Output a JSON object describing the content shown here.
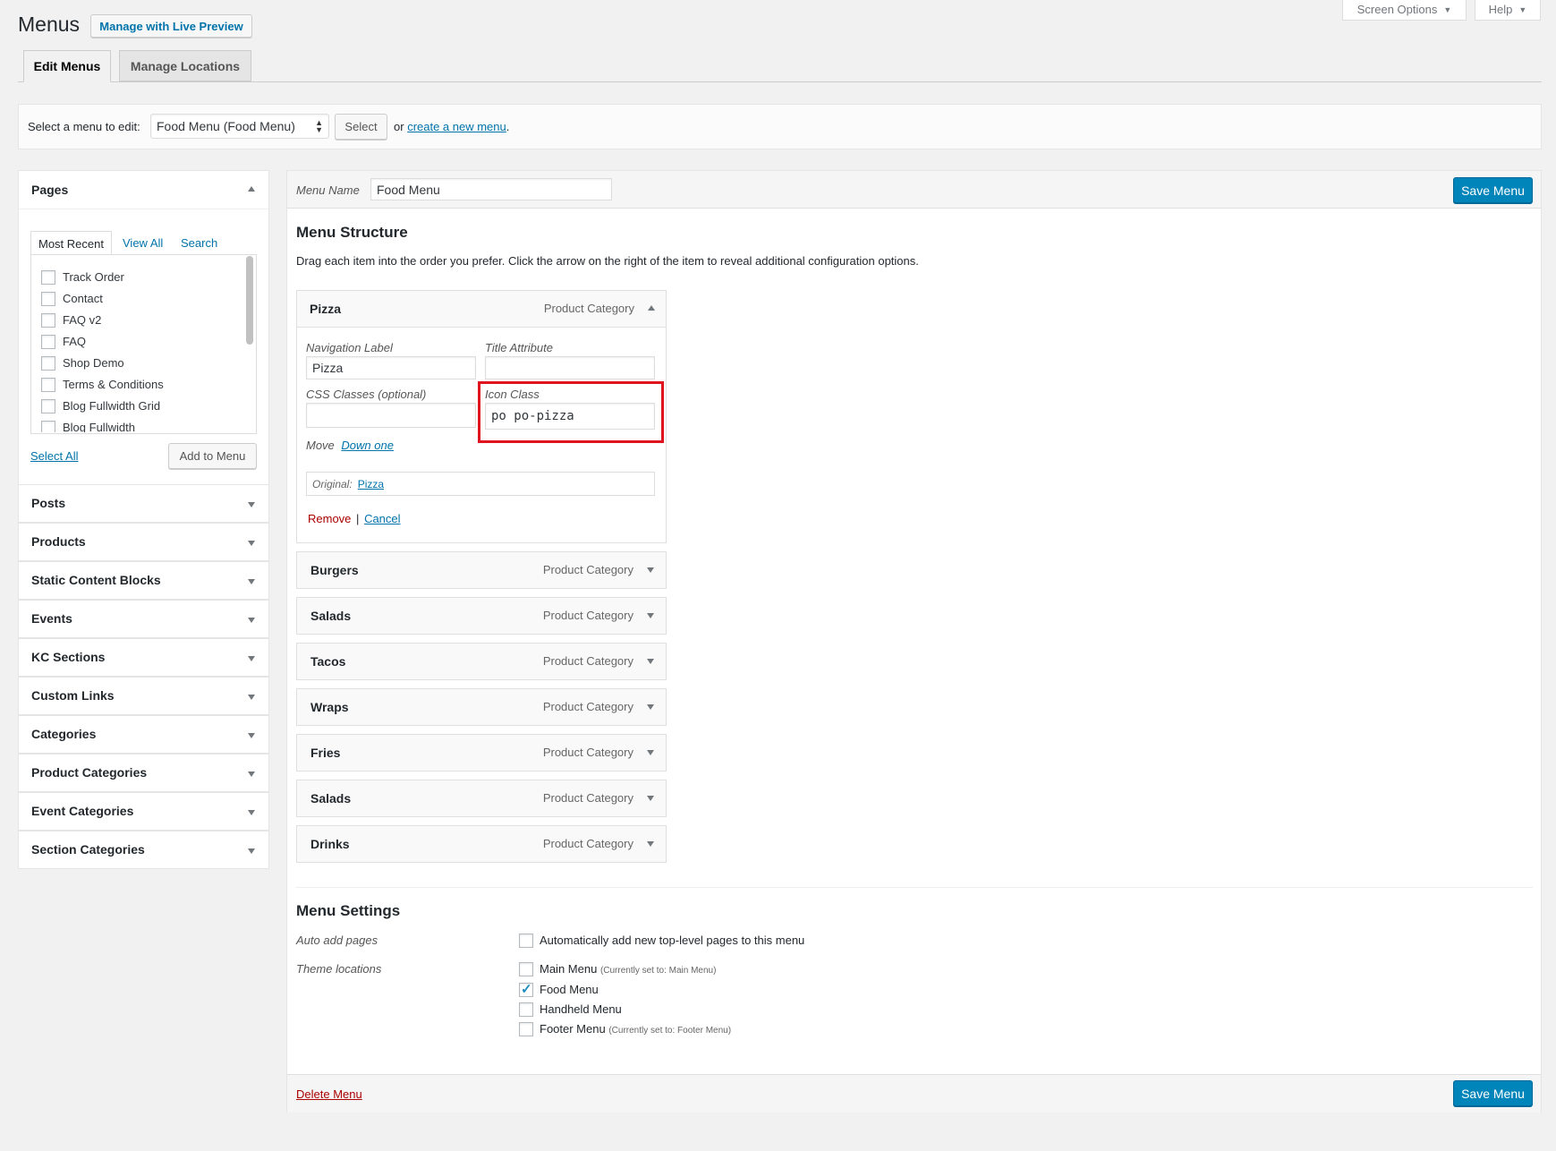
{
  "header": {
    "title": "Menus",
    "live_preview": "Manage with Live Preview",
    "screen_options": "Screen Options",
    "help": "Help"
  },
  "tabs": [
    {
      "label": "Edit Menus",
      "active": true
    },
    {
      "label": "Manage Locations",
      "active": false
    }
  ],
  "select_bar": {
    "prompt": "Select a menu to edit:",
    "selected": "Food Menu (Food Menu)",
    "select_button": "Select",
    "or_text": "or",
    "create_link": "create a new menu",
    "period": "."
  },
  "sidebar": {
    "pages": {
      "title": "Pages",
      "tabs": [
        "Most Recent",
        "View All",
        "Search"
      ],
      "items": [
        "Track Order",
        "Contact",
        "FAQ v2",
        "FAQ",
        "Shop Demo",
        "Terms & Conditions",
        "Blog Fullwidth Grid",
        "Blog Fullwidth"
      ],
      "select_all": "Select All",
      "add_button": "Add to Menu"
    },
    "sections": [
      "Posts",
      "Products",
      "Static Content Blocks",
      "Events",
      "KC Sections",
      "Custom Links",
      "Categories",
      "Product Categories",
      "Event Categories",
      "Section Categories"
    ]
  },
  "menu": {
    "name_label": "Menu Name",
    "name_value": "Food Menu",
    "save_label": "Save Menu",
    "structure_title": "Menu Structure",
    "structure_desc": "Drag each item into the order you prefer. Click the arrow on the right of the item to reveal additional configuration options.",
    "expanded_item": {
      "title": "Pizza",
      "type": "Product Category",
      "nav_label_title": "Navigation Label",
      "nav_label_value": "Pizza",
      "title_attr_title": "Title Attribute",
      "title_attr_value": "",
      "css_title": "CSS Classes (optional)",
      "css_value": "",
      "icon_title": "Icon Class",
      "icon_value": "po po-pizza",
      "move_label": "Move",
      "move_link": "Down one",
      "original_label": "Original:",
      "original_link": "Pizza",
      "remove": "Remove",
      "separator": "|",
      "cancel": "Cancel"
    },
    "items": [
      {
        "title": "Burgers",
        "type": "Product Category"
      },
      {
        "title": "Salads",
        "type": "Product Category"
      },
      {
        "title": "Tacos",
        "type": "Product Category"
      },
      {
        "title": "Wraps",
        "type": "Product Category"
      },
      {
        "title": "Fries",
        "type": "Product Category"
      },
      {
        "title": "Salads",
        "type": "Product Category"
      },
      {
        "title": "Drinks",
        "type": "Product Category"
      }
    ],
    "settings": {
      "title": "Menu Settings",
      "auto_add_label": "Auto add pages",
      "auto_add_text": "Automatically add new top-level pages to this menu",
      "locations_label": "Theme locations",
      "locations": [
        {
          "name": "Main Menu",
          "note": "(Currently set to: Main Menu)",
          "checked": false
        },
        {
          "name": "Food Menu",
          "note": "",
          "checked": true
        },
        {
          "name": "Handheld Menu",
          "note": "",
          "checked": false
        },
        {
          "name": "Footer Menu",
          "note": "(Currently set to: Footer Menu)",
          "checked": false
        }
      ]
    },
    "delete_label": "Delete Menu"
  },
  "colors": {
    "primary": "#0085ba",
    "link": "#0073aa",
    "delete": "#a00",
    "highlight": "#e0141e"
  }
}
